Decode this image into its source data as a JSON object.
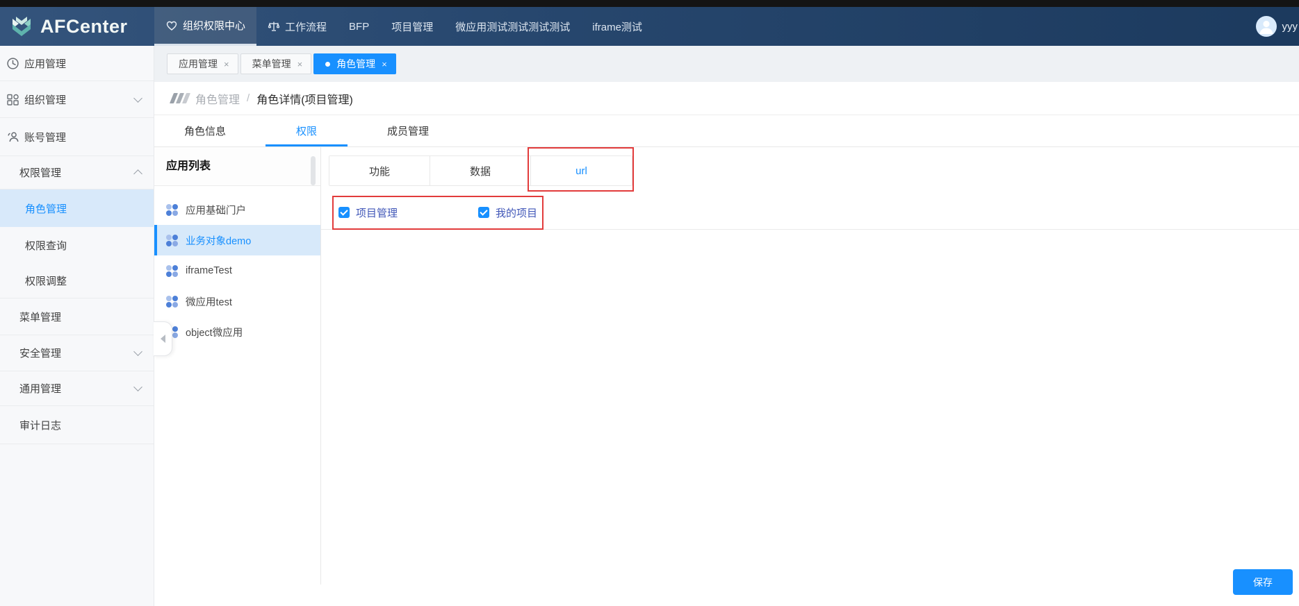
{
  "brand": {
    "name": "AFCenter"
  },
  "navbar": {
    "items": [
      {
        "label": "组织权限中心",
        "icon": "heart-icon",
        "active": true
      },
      {
        "label": "工作流程",
        "icon": "scale-icon",
        "active": false
      },
      {
        "label": "BFP",
        "active": false
      },
      {
        "label": "项目管理",
        "active": false
      },
      {
        "label": "微应用测试测试测试测试",
        "active": false
      },
      {
        "label": "iframe测试",
        "active": false
      }
    ],
    "user": {
      "name": "yyy"
    }
  },
  "tabstrip": {
    "close_glyph": "×",
    "tabs": [
      {
        "label": "应用管理",
        "active": false
      },
      {
        "label": "菜单管理",
        "active": false
      },
      {
        "label": "角色管理",
        "active": true
      }
    ]
  },
  "breadcrumb": {
    "section": "角色管理",
    "separator": "/",
    "current": "角色详情(项目管理)"
  },
  "page_tabs": [
    {
      "label": "角色信息",
      "active": false
    },
    {
      "label": "权限",
      "active": true
    },
    {
      "label": "成员管理",
      "active": false
    }
  ],
  "sidebar": {
    "items": [
      {
        "label": "应用管理",
        "icon": "clock-icon"
      },
      {
        "label": "组织管理",
        "icon": "org-icon",
        "chevron": "down"
      },
      {
        "label": "账号管理",
        "icon": "user-icon"
      },
      {
        "label": "权限管理",
        "chevron": "up"
      },
      {
        "label": "角色管理",
        "active": true
      },
      {
        "label": "权限查询"
      },
      {
        "label": "权限调整"
      },
      {
        "label": "菜单管理"
      },
      {
        "label": "安全管理",
        "chevron": "down"
      },
      {
        "label": "通用管理",
        "chevron": "down"
      },
      {
        "label": "审计日志"
      }
    ]
  },
  "app_panel": {
    "title": "应用列表",
    "apps": [
      {
        "label": "应用基础门户",
        "active": false
      },
      {
        "label": "业务对象demo",
        "active": true
      },
      {
        "label": "iframeTest",
        "active": false
      },
      {
        "label": "微应用test",
        "active": false
      },
      {
        "label": "object微应用",
        "active": false
      }
    ]
  },
  "perm_panel": {
    "tabs": [
      {
        "label": "功能",
        "active": false
      },
      {
        "label": "数据",
        "active": false
      },
      {
        "label": "url",
        "active": true
      }
    ],
    "url_items": [
      {
        "label": "项目管理",
        "checked": true
      },
      {
        "label": "我的项目",
        "checked": true
      }
    ]
  },
  "footer": {
    "save_label": "保存"
  },
  "colors": {
    "accent": "#1890ff",
    "annotation_red": "#e23b3b",
    "navbar_gradient_start": "#34547c",
    "navbar_gradient_end": "#1c3a5e",
    "checkbox_label_blue": "#4157b8",
    "sidebar_active_bg": "#d8e9fa"
  }
}
